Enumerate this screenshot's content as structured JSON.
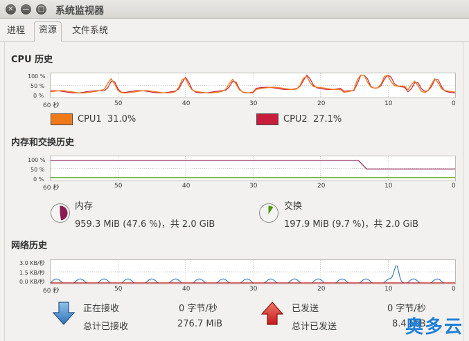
{
  "window": {
    "title": "系统监视器",
    "close_glyph": "✕",
    "minimize_glyph": "—",
    "maximize_glyph": "□"
  },
  "tabs": [
    {
      "label": "进程",
      "active": false
    },
    {
      "label": "资源",
      "active": true
    },
    {
      "label": "文件系统",
      "active": false
    }
  ],
  "cpu": {
    "title": "CPU 历史",
    "y_ticks": [
      "100 %",
      "50 %",
      "0 %"
    ],
    "x_ticks": [
      "60 秒",
      "50",
      "40",
      "30",
      "20",
      "10",
      "0"
    ],
    "legend": [
      {
        "label": "CPU1",
        "value": "31.0%",
        "color": "#f07a1a"
      },
      {
        "label": "CPU2",
        "value": "27.1%",
        "color": "#c81e3c"
      }
    ]
  },
  "memory": {
    "title": "内存和交换历史",
    "y_ticks": [
      "100 %",
      "50 %",
      "0 %"
    ],
    "x_ticks": [
      "60 秒",
      "50",
      "40",
      "30",
      "20",
      "10",
      "0"
    ],
    "mem_label": "内存",
    "mem_value": "959.3 MiB (47.6 %)，共 2.0 GiB",
    "mem_fraction": 0.476,
    "mem_color": "#8b1c50",
    "swap_label": "交换",
    "swap_value": "197.9 MiB (9.7 %)，共 2.0 GiB",
    "swap_fraction": 0.097,
    "swap_color": "#4e9a06"
  },
  "network": {
    "title": "网络历史",
    "y_ticks": [
      "3.0 KB/秒",
      "1.5 KB/秒",
      "0.0 KB/秒"
    ],
    "x_ticks": [
      "60 秒",
      "50",
      "40",
      "30",
      "20",
      "10",
      "0"
    ],
    "recv_label": "正在接收",
    "recv_rate": "0 字节/秒",
    "recv_total_label": "总计已接收",
    "recv_total": "276.7 MiB",
    "send_label": "已发送",
    "send_rate": "0 字节/秒",
    "send_total_label": "总计已发送",
    "send_total": "8.4 MiB"
  },
  "watermark": "奥多云"
}
